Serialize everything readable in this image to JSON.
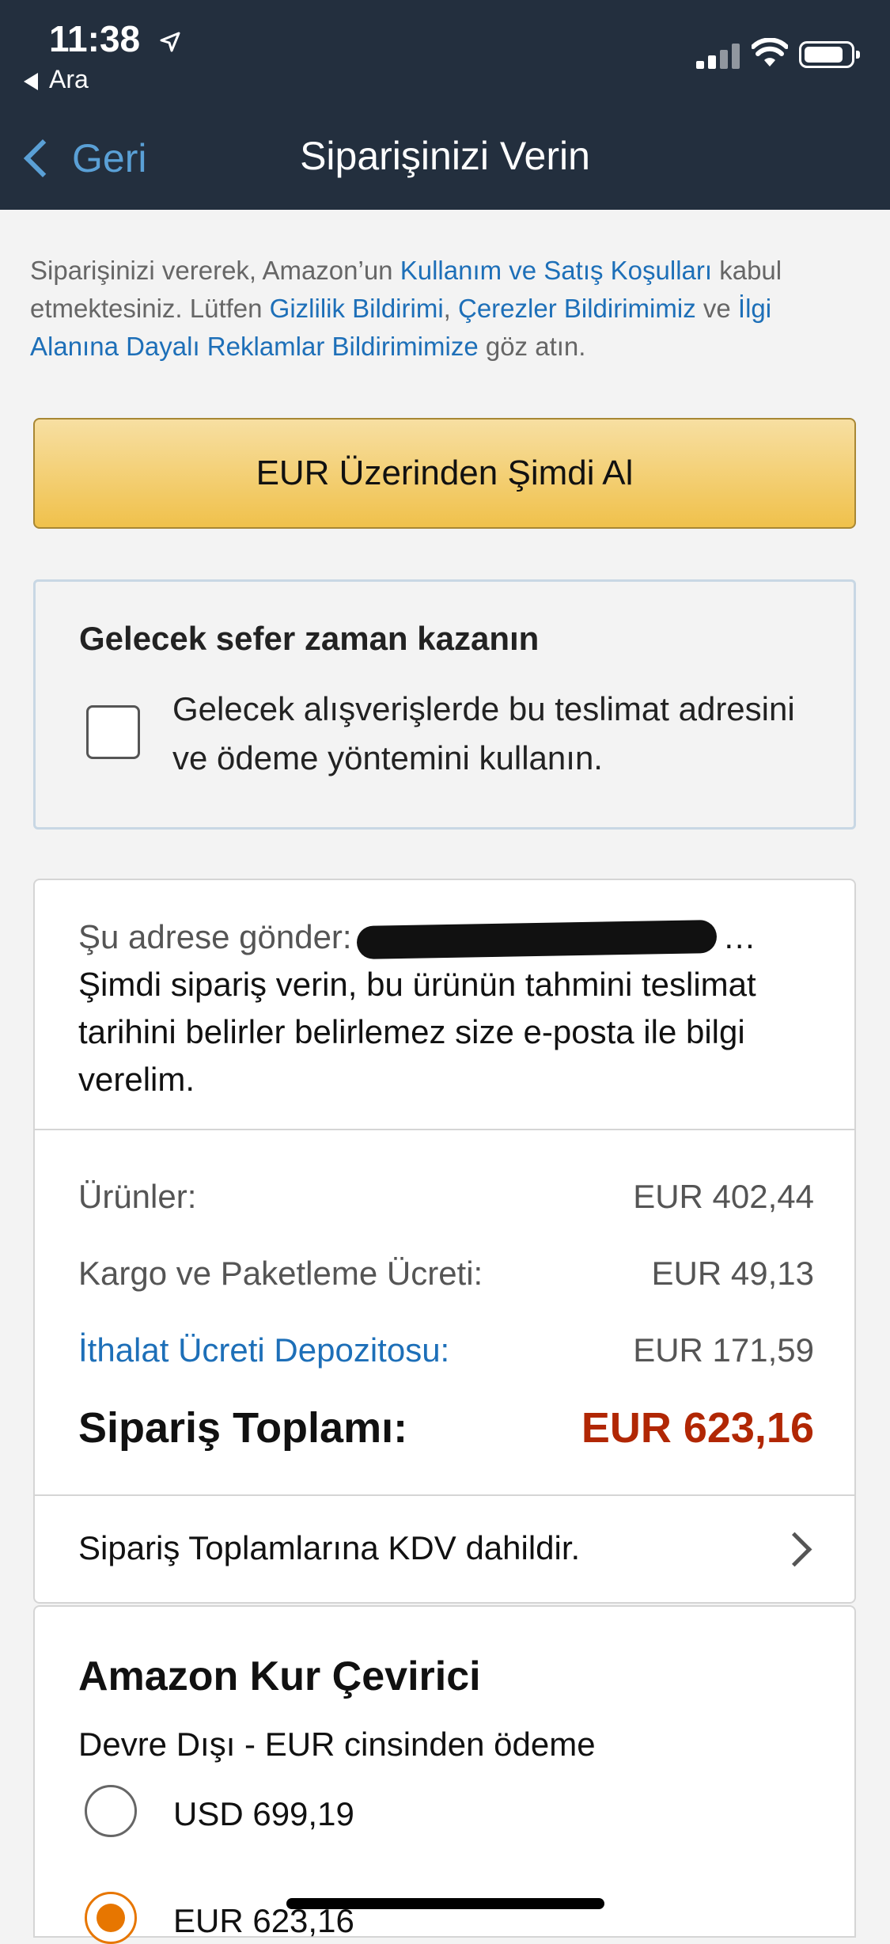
{
  "status_bar": {
    "time": "11:38",
    "back_app": "Ara"
  },
  "nav": {
    "back_label": "Geri",
    "title": "Siparişinizi Verin"
  },
  "terms": {
    "p1": "Siparişinizi vererek, Amazon’un ",
    "link1": "Kullanım ve Satış Koşulları",
    "p2": " kabul etmektesiniz. Lütfen ",
    "link2": "Gizlilik Bildirimi",
    "p3": ", ",
    "link3": "Çerezler Bildirimimiz",
    "p4": " ve ",
    "link4": "İlgi Alanına Dayalı Reklamlar Bildirimimize",
    "p5": " göz atın."
  },
  "buy_button": {
    "label": "EUR Üzerinden Şimdi Al"
  },
  "save_time": {
    "title": "Gelecek sefer zaman kazanın",
    "checkbox_label": "Gelecek alışverişlerde bu teslimat adresini ve ödeme yöntemini kullanın.",
    "checked": false
  },
  "shipping": {
    "prefix": "Şu adrese gönder:",
    "address_tail": "…",
    "message": "Şimdi sipariş verin, bu ürünün tahmini teslimat tarihini belirler belirlemez size e-posta ile bilgi verelim."
  },
  "summary": {
    "items_label": "Ürünler:",
    "items_value": "EUR 402,44",
    "shipping_label": "Kargo ve Paketleme Ücreti:",
    "shipping_value": "EUR 49,13",
    "import_label": "İthalat Ücreti Depozitosu:",
    "import_value": "EUR 171,59",
    "total_label": "Sipariş Toplamı:",
    "total_value": "EUR 623,16"
  },
  "vat_note": "Sipariş Toplamlarına KDV dahildir.",
  "converter": {
    "title": "Amazon Kur Çevirici",
    "subtitle": "Devre Dışı - EUR cinsinden ödeme",
    "options": [
      {
        "label": "USD 699,19",
        "selected": false
      },
      {
        "label": "EUR 623,16",
        "selected": true
      }
    ]
  },
  "colors": {
    "header_bg": "#232f3e",
    "link": "#1d6fb8",
    "buy_button": "#f0c14b",
    "total": "#b12704",
    "radio_selected": "#e77600"
  }
}
